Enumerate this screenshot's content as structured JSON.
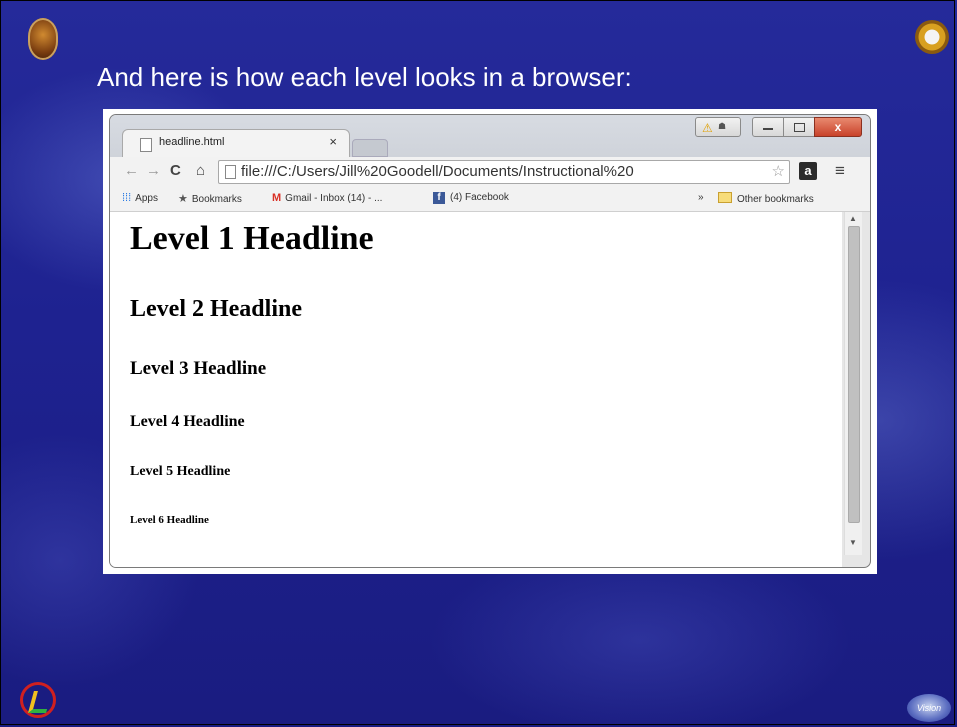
{
  "slide": {
    "title": "And here is how each level looks in a browser:",
    "corner_logo_br": "Vision"
  },
  "browser": {
    "tab": {
      "title": "headline.html",
      "close": "×"
    },
    "window_controls": {
      "close": "x"
    },
    "address": "file:///C:/Users/Jill%20Goodell/Documents/Instructional%20",
    "extension_label": "a",
    "menu": "≡",
    "nav": {
      "back": "←",
      "forward": "→",
      "reload": "C",
      "home": "⌂"
    },
    "bookmarks": [
      {
        "icon": "apps-icon",
        "label": "Apps"
      },
      {
        "icon": "star-icon",
        "label": "Bookmarks"
      },
      {
        "icon": "gmail-icon",
        "label": "Gmail - Inbox (14) - ..."
      },
      {
        "icon": "facebook-icon",
        "label": "(4) Facebook"
      }
    ],
    "bookmarks_overflow": "»",
    "other_bookmarks": "Other bookmarks"
  },
  "page": {
    "h1": "Level 1 Headline",
    "h2": "Level 2 Headline",
    "h3": "Level 3 Headline",
    "h4": "Level 4 Headline",
    "h5": "Level 5 Headline",
    "h6": "Level 6 Headline"
  },
  "colors": {
    "slide_background": "#1b1f86",
    "title_text": "#ffffff",
    "window_close": "#c8422a"
  }
}
